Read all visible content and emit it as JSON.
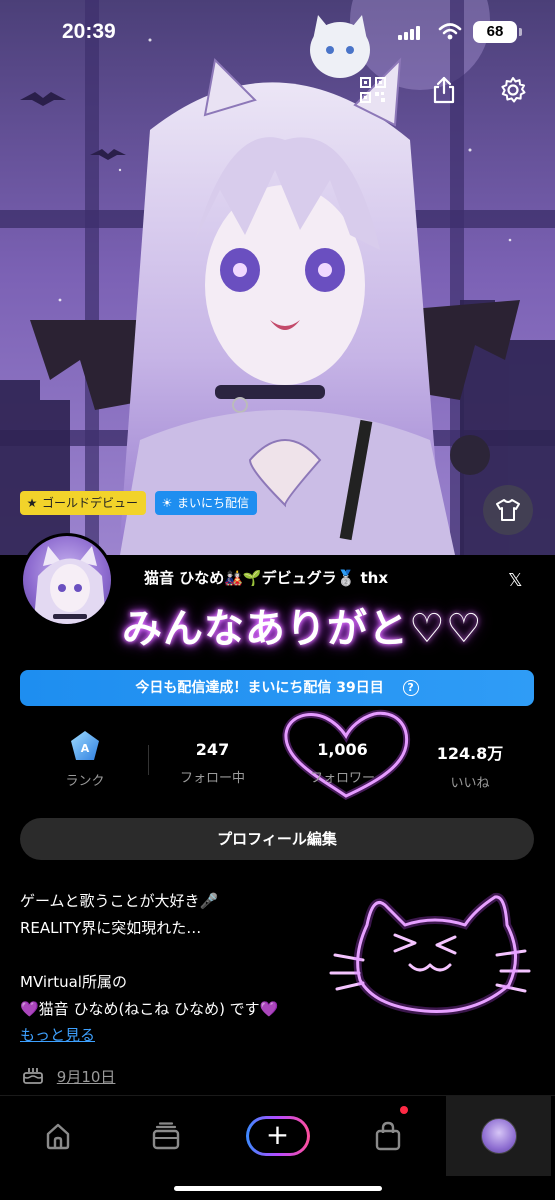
{
  "status_bar": {
    "time": "20:39",
    "battery": "68"
  },
  "hero": {
    "badges": {
      "gold": "ゴールドデビュー",
      "daily": "まいにち配信"
    },
    "top_icons": [
      "qr-code-icon",
      "share-icon",
      "settings-gear-icon"
    ]
  },
  "profile": {
    "name": "猫音 ひなめ🎎🌱デビュグラ🥈 thx",
    "handwritten_message": "みんなありがと♡♡",
    "daily_banner": "今日も配信達成！まいにち配信 39日目",
    "stats": {
      "rank_label": "ランク",
      "rank_value": "A",
      "following_count": "247",
      "following_label": "フォロー中",
      "followers_count": "1,006",
      "followers_label": "フォロワー",
      "likes_count": "124.8万",
      "likes_label": "いいね"
    },
    "edit_button": "プロフィール編集",
    "bio_lines": [
      "ゲームと歌うことが大好き🎤",
      "REALITY界に突如現れた…",
      "",
      "MVirtual所属の",
      "💜猫音 ひなめ(ねこね ひなめ) です💜"
    ],
    "more_link": "もっと見る",
    "birthday": "9月10日"
  },
  "nav": {
    "items": [
      "home-icon",
      "feed-cards-icon",
      "create-plus-icon",
      "shop-bag-icon",
      "profile-avatar"
    ]
  },
  "colors": {
    "accent_blue": "#1e8ef0",
    "gold_badge": "#f2d32a",
    "link": "#3ea1ff",
    "neon_pink": "#d35cff"
  }
}
